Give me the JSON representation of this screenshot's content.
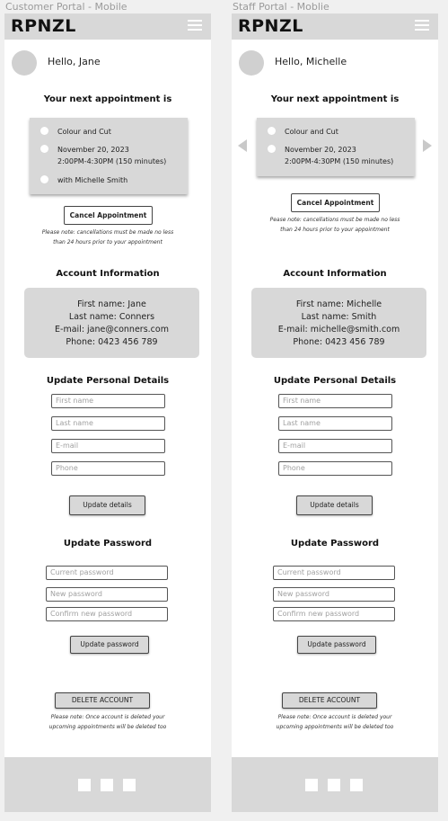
{
  "customer": {
    "frame_label": "Customer Portal -  Mobile",
    "logo": "RPNZL",
    "greeting": "Hello, Jane",
    "appointment_title": "Your next appointment is",
    "appointment": {
      "service": "Colour and Cut",
      "date": "November 20, 2023",
      "time": "2:00PM-4:30PM (150 minutes)",
      "stylist": "with Michelle Smith"
    },
    "cancel_label": "Cancel Appointment",
    "cancel_note_1": "Please note: cancellations must be made no less",
    "cancel_note_2": "than 24 hours prior to your appointment",
    "account_title": "Account Information",
    "account": {
      "first": "First name: Jane",
      "last": "Last name: Conners",
      "email": "E-mail: jane@conners.com",
      "phone": "Phone: 0423 456 789"
    },
    "personal_title": "Update Personal Details",
    "ph_first": "First name",
    "ph_last": "Last name",
    "ph_email": "E-mail",
    "ph_phone": "Phone",
    "update_details_label": "Update details",
    "password_title": "Update Password",
    "ph_current": "Current password",
    "ph_new": "New password",
    "ph_confirm": "Confirm new password",
    "update_password_label": "Update password",
    "delete_label": "DELETE ACCOUNT",
    "delete_note_1": "Please note: Once account is deleted your",
    "delete_note_2": "upcoming appointments will be deleted too"
  },
  "staff": {
    "frame_label": "Staff Portal - Moblie",
    "logo": "RPNZL",
    "greeting": "Hello, Michelle",
    "appointment_title": "Your next appointment is",
    "appointment": {
      "service": "Colour and Cut",
      "date": "November 20, 2023",
      "time": "2:00PM-4:30PM (150 minutes)"
    },
    "cancel_label": "Cancel Appointment",
    "cancel_note_1": "Pease note: cancellations must be made no less",
    "cancel_note_2": "than 24 hours prior to your appointment",
    "account_title": "Account Information",
    "account": {
      "first": "First name: Michelle",
      "last": "Last name: Smith",
      "email": "E-mail: michelle@smith.com",
      "phone": "Phone: 0423 456 789"
    },
    "personal_title": "Update Personal Details",
    "ph_first": "First name",
    "ph_last": "Last name",
    "ph_email": "E-mail",
    "ph_phone": "Phone",
    "update_details_label": "Update details",
    "password_title": "Update Password",
    "ph_current": "Current password",
    "ph_new": "New password",
    "ph_confirm": "Confirm new password",
    "update_password_label": "Update password",
    "delete_label": "DELETE ACCOUNT",
    "delete_note_1": "Please note: Once account is deleted your",
    "delete_note_2": "upcoming appointments will be deleted too"
  },
  "icons": {
    "menu": "hamburger-menu-icon",
    "avatar": "avatar-placeholder",
    "prev": "triangle-left-icon",
    "next": "triangle-right-icon"
  }
}
